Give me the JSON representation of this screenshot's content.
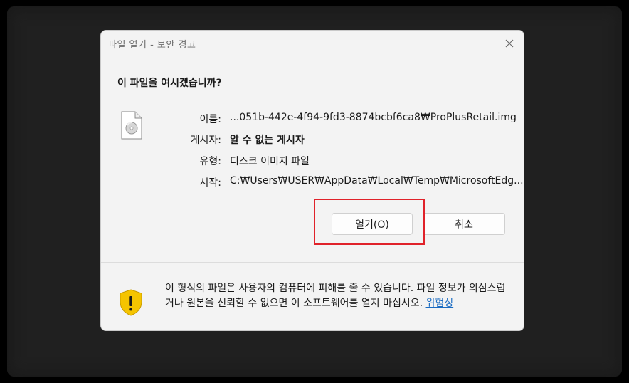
{
  "dialog": {
    "title": "파일 열기 - 보안 경고",
    "question": "이 파일을 여시겠습니까?",
    "fields": [
      {
        "label": "이름:",
        "value": "...051b-442e-4f94-9fd3-8874bcbf6ca8₩ProPlusRetail.img",
        "bold": false
      },
      {
        "label": "게시자:",
        "value": "알 수 없는 게시자",
        "bold": true
      },
      {
        "label": "유형:",
        "value": "디스크 이미지 파일",
        "bold": false
      },
      {
        "label": "시작:",
        "value": "C:₩Users₩USER₩AppData₩Local₩Temp₩MicrosoftEdg...",
        "bold": false
      }
    ],
    "open_button": "열기(O)",
    "cancel_button": "취소",
    "warning_text": "이 형식의 파일은 사용자의 컴퓨터에 피해를 줄 수 있습니다. 파일 정보가 의심스럽거나 원본을 신뢰할 수 없으면 이 소프트웨어를 열지 마십시오.",
    "risk_link": "위험성"
  },
  "colors": {
    "highlight": "#e0222a",
    "link": "#1a6bc2",
    "shield": "#f5c400"
  }
}
